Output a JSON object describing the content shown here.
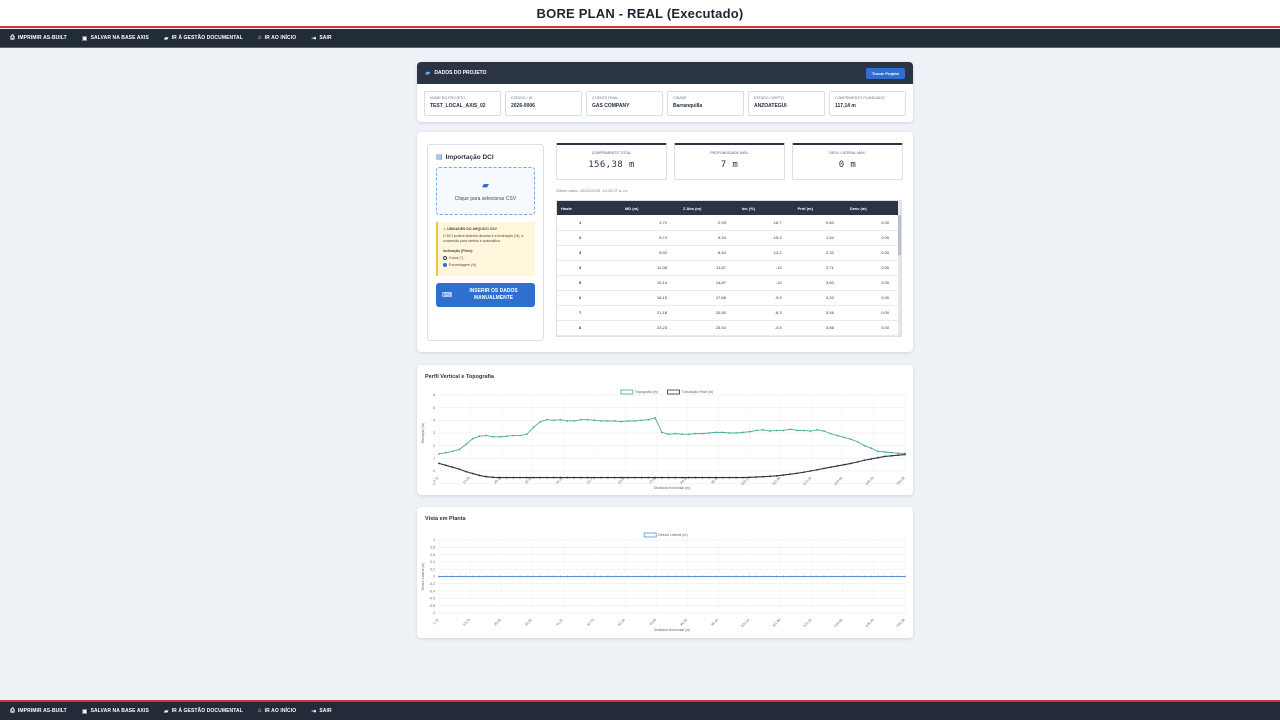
{
  "app": {
    "title": "BORE PLAN - REAL (Executado)"
  },
  "nav": {
    "items": [
      {
        "label": "IMPRIMIR AS-BUILT",
        "icon": "print-icon"
      },
      {
        "label": "SALVAR NA BASE AXIS",
        "icon": "save-icon"
      },
      {
        "label": "IR À GESTÃO DOCUMENTAL",
        "icon": "folder-icon"
      },
      {
        "label": "IR AO INÍCIO",
        "icon": "home-icon"
      },
      {
        "label": "SAIR",
        "icon": "logout-icon"
      }
    ]
  },
  "project": {
    "title": "DADOS DO PROJETO",
    "icon": "folder-icon",
    "change_button": "Trocar Projeto",
    "fields": [
      {
        "label": "NOME DO PROJETO",
        "value": "TEST_LOCAL_AXIS_02"
      },
      {
        "label": "CÓDIGO / ID",
        "value": "2026-0006"
      },
      {
        "label": "CLIENTE FINAL",
        "value": "GAS COMPANY"
      },
      {
        "label": "CIDADE",
        "value": "Barranquilla"
      },
      {
        "label": "ESTADO / DEPTO.",
        "value": "ANZOATEGUI"
      },
      {
        "label": "COMPRIMENTO PLANEJADO",
        "value": "117,14 m"
      }
    ]
  },
  "dci": {
    "title": "Importação DCI",
    "icon": "file-import-icon",
    "drop_text": "Clique para selecionar CSV",
    "drop_icon": "folder-open-icon",
    "units_heading": "⚠ UNIDADES DO ARQUIVO CSV",
    "units_note": "O DCI poderá sistema decimal e a inclinação (%), a conversão para metros é automática",
    "incl_label": "Inclinação (Pitch):",
    "options": [
      {
        "label": "Graus (°)",
        "selected": false
      },
      {
        "label": "Porcentagem (%)",
        "selected": true
      }
    ],
    "manual_button": "INSERIR OS DADOS MANUALMENTE",
    "manual_icon": "keyboard-icon"
  },
  "stats": [
    {
      "label": "COMPRIMENTO TOTAL",
      "value": "156,38 m"
    },
    {
      "label": "PROFUNDIDADE MÁX.",
      "value": "7 m"
    },
    {
      "label": "DESV. LATERAL MÁX.",
      "value": "0 m"
    }
  ],
  "last_save": "Último salvo: 15/01/2026, 10:33:27 a. m.",
  "table": {
    "headers": [
      "Haste",
      "MD (m)",
      "Z Abs (m)",
      "Inc (%)",
      "Prof (m)",
      "Desv (m)"
    ],
    "rows": [
      [
        "1",
        "2,72",
        "2,93",
        "-16,7",
        "0,60",
        "0,00"
      ],
      [
        "2",
        "5,74",
        "5,34",
        "-15,3",
        "1,54",
        "0,00"
      ],
      [
        "3",
        "8,92",
        "8,84",
        "-13,2",
        "2,32",
        "0,00"
      ],
      [
        "4",
        "12,08",
        "11,87",
        "-13",
        "2,71",
        "0,00"
      ],
      [
        "5",
        "15,14",
        "14,87",
        "-13",
        "3,60",
        "0,00"
      ],
      [
        "6",
        "18,15",
        "17,88",
        "-9,5",
        "3,32",
        "0,00"
      ],
      [
        "7",
        "21,18",
        "20,50",
        "-6,3",
        "3,56",
        "0,00"
      ],
      [
        "8",
        "23,23",
        "23,54",
        "-4,5",
        "3,86",
        "0,00"
      ]
    ]
  },
  "chart_data": [
    {
      "type": "line",
      "title": "Perfil Vertical e Topografia",
      "xlabel": "Distância Horizontal (m)",
      "ylabel": "Elevação (m)",
      "ylim": [
        0,
        6
      ],
      "x": [
        "2,72",
        "",
        "",
        "",
        "5,53",
        "",
        "",
        "",
        "20,33",
        "",
        "",
        "",
        "",
        "",
        "41,22",
        "",
        "",
        "",
        "",
        "52,71",
        "",
        "",
        "",
        "60,26",
        "",
        "",
        "",
        "",
        "",
        "",
        "73,93",
        "",
        "",
        "",
        "",
        "",
        "",
        "",
        "",
        "",
        "101,14",
        "",
        "",
        "",
        "109,64",
        "",
        "",
        "",
        "",
        "",
        "123,62",
        "",
        "",
        "",
        "",
        "",
        "",
        "",
        "",
        "",
        "",
        "",
        "146,33",
        "",
        "",
        "",
        "",
        "",
        "156,38"
      ],
      "x_ticks": [
        "2,72",
        "13,23",
        "20,33",
        "31,85",
        "41,22",
        "52,71",
        "63,34",
        "73,93",
        "84,36",
        "95,44",
        "101,14",
        "112,06",
        "122,25",
        "134,66",
        "146,33",
        "156,38"
      ],
      "legend": "top-center",
      "grid": true,
      "series": [
        {
          "name": "Topografia (m)",
          "color": "#4aab9b",
          "values": [
            1.35,
            1.45,
            1.55,
            1.7,
            2.1,
            2.55,
            2.75,
            2.8,
            2.7,
            2.7,
            2.75,
            2.8,
            2.8,
            2.9,
            3.45,
            3.9,
            4.05,
            4.0,
            4.05,
            3.95,
            3.95,
            4.05,
            4.05,
            4.0,
            3.95,
            3.95,
            3.95,
            3.9,
            3.95,
            3.95,
            4.0,
            4.05,
            4.2,
            3.05,
            2.9,
            2.95,
            2.9,
            2.9,
            2.95,
            2.95,
            3.0,
            3.05,
            3.05,
            3.0,
            3.0,
            3.05,
            3.1,
            3.2,
            3.25,
            3.15,
            3.2,
            3.2,
            3.3,
            3.2,
            3.2,
            3.15,
            3.25,
            3.15,
            2.95,
            2.8,
            2.65,
            2.5,
            2.3,
            2.0,
            1.8,
            1.55,
            1.5,
            1.45,
            1.4,
            1.4
          ]
        },
        {
          "name": "Tubulação Real (m)",
          "color": "#2a3445",
          "values": [
            0.6,
            0.45,
            0.3,
            0.15,
            -0.05,
            -0.2,
            -0.35,
            -0.45,
            -0.5,
            -0.52,
            -0.52,
            -0.52,
            -0.52,
            -0.52,
            -0.52,
            -0.52,
            -0.52,
            -0.52,
            -0.52,
            -0.52,
            -0.52,
            -0.52,
            -0.52,
            -0.52,
            -0.52,
            -0.52,
            -0.52,
            -0.52,
            -0.52,
            -0.52,
            -0.52,
            -0.52,
            -0.52,
            -0.52,
            -0.52,
            -0.52,
            -0.52,
            -0.52,
            -0.52,
            -0.52,
            -0.52,
            -0.52,
            -0.52,
            -0.52,
            -0.52,
            -0.52,
            -0.5,
            -0.48,
            -0.45,
            -0.42,
            -0.38,
            -0.32,
            -0.25,
            -0.18,
            -0.1,
            0.0,
            0.1,
            0.2,
            0.3,
            0.4,
            0.5,
            0.6,
            0.72,
            0.85,
            0.95,
            1.05,
            1.15,
            1.2,
            1.25,
            1.3
          ]
        }
      ]
    },
    {
      "type": "line",
      "title": "Vista em Planta",
      "xlabel": "Distância Horizontal (m)",
      "ylabel": "Desvio Lateral (m)",
      "ylim": [
        -1,
        1
      ],
      "x_ticks": [
        "2,72",
        "13,23",
        "20,33",
        "31,85",
        "41,22",
        "52,71",
        "63,34",
        "73,93",
        "84,36",
        "95,44",
        "101,14",
        "112,06",
        "122,25",
        "134,66",
        "146,33",
        "156,38"
      ],
      "legend": "top-center",
      "grid": true,
      "series": [
        {
          "name": "Desvio Lateral (m)",
          "color": "#5a8fd0",
          "values": [
            0,
            0,
            0,
            0,
            0,
            0,
            0,
            0,
            0,
            0,
            0,
            0,
            0,
            0,
            0,
            0,
            0,
            0,
            0,
            0,
            0,
            0,
            0,
            0,
            0,
            0,
            0,
            0,
            0,
            0,
            0,
            0,
            0,
            0,
            0,
            0,
            0,
            0,
            0,
            0,
            0,
            0,
            0,
            0,
            0,
            0,
            0,
            0,
            0,
            0,
            0,
            0,
            0,
            0,
            0,
            0,
            0,
            0,
            0,
            0,
            0,
            0,
            0,
            0,
            0,
            0,
            0,
            0,
            0,
            0
          ]
        }
      ]
    }
  ],
  "chart1_yticks": [
    "6",
    "5",
    "4",
    "3",
    "2",
    "1",
    "0",
    "-1",
    "-2"
  ],
  "chart2_yticks": [
    "1",
    "0.8",
    "0.6",
    "0.4",
    "0.2",
    "0",
    "-0.2",
    "-0.4",
    "-0.6",
    "-0.8",
    "-1"
  ]
}
